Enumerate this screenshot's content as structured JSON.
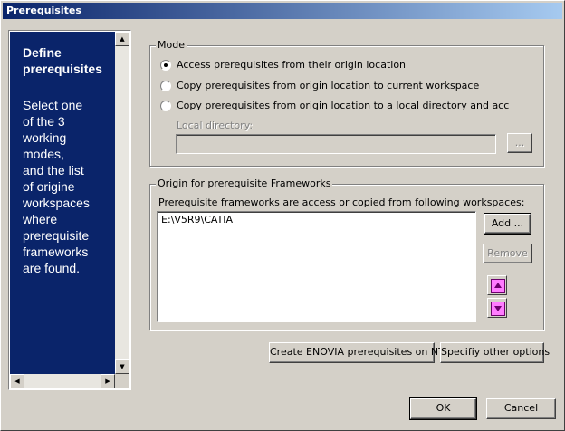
{
  "window": {
    "title": "Prerequisites"
  },
  "help": {
    "title": "Define\nprerequisites",
    "text": "Select one\nof the 3\nworking\nmodes,\nand the list\nof origine\nworkspaces\nwhere\nprerequisite\nframeworks\nare found."
  },
  "mode": {
    "legend": "Mode",
    "options": [
      {
        "label": "Access prerequisites from their origin location",
        "checked": true
      },
      {
        "label": "Copy prerequisites from origin location to current workspace",
        "checked": false
      },
      {
        "label": "Copy prerequisites from origin location to a local directory and acc",
        "checked": false
      }
    ],
    "local_dir_label": "Local directory:",
    "local_dir_value": "",
    "browse_label": "..."
  },
  "origin": {
    "legend": "Origin for prerequisite Frameworks",
    "description": "Prerequisite frameworks are access or copied from following workspaces:",
    "workspaces": [
      "E:\\V5R9\\CATIA"
    ],
    "add_label": "Add ...",
    "remove_label": "Remove",
    "move_up_icon": "up-arrow-icon",
    "move_down_icon": "down-arrow-icon"
  },
  "actions": {
    "enovia_label": "Create ENOVIA prerequisites on NT...",
    "options_label": "Specifiy other options"
  },
  "footer": {
    "ok_label": "OK",
    "cancel_label": "Cancel"
  }
}
